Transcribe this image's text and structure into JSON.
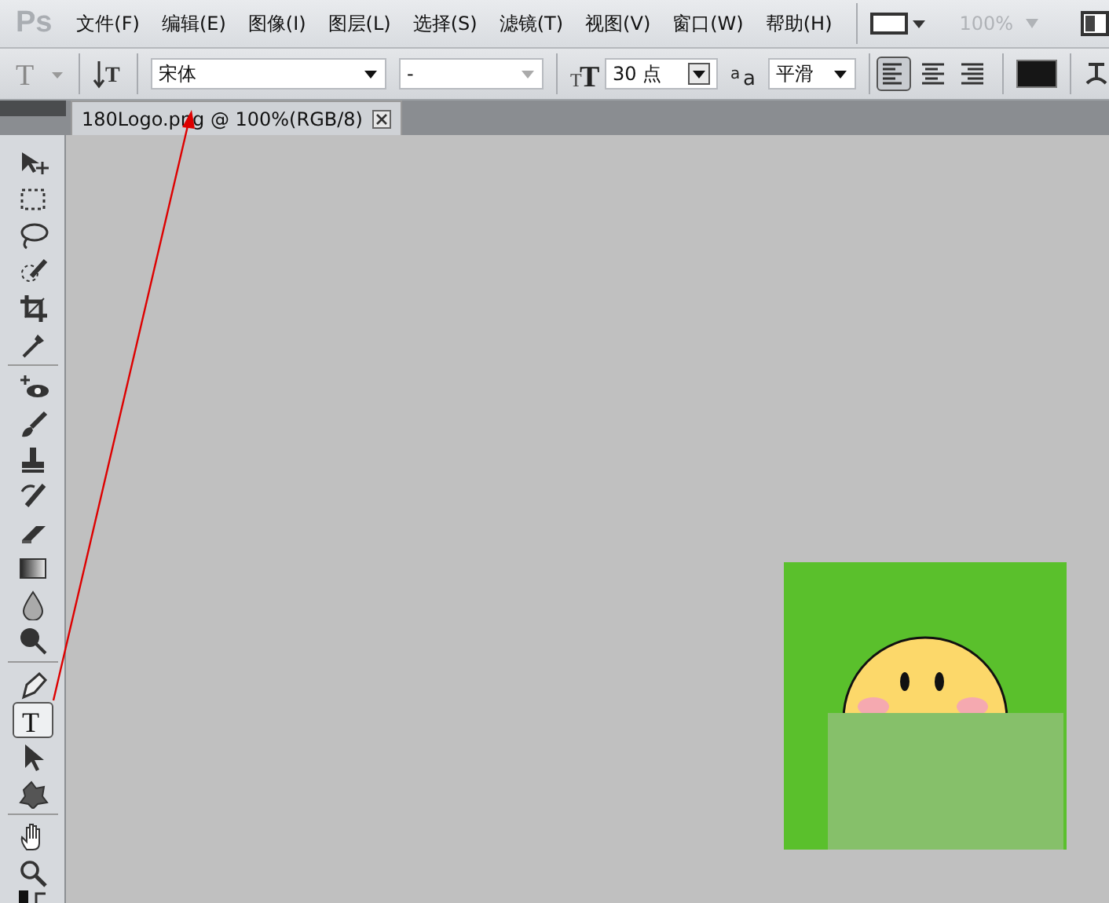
{
  "app_logo": "Ps",
  "menu": [
    {
      "label": "文件(F)"
    },
    {
      "label": "编辑(E)"
    },
    {
      "label": "图像(I)"
    },
    {
      "label": "图层(L)"
    },
    {
      "label": "选择(S)"
    },
    {
      "label": "滤镜(T)"
    },
    {
      "label": "视图(V)"
    },
    {
      "label": "窗口(W)"
    },
    {
      "label": "帮助(H)"
    }
  ],
  "zoom_level": {
    "value": "100%",
    "disabled": true
  },
  "options_bar": {
    "tool_preset_glyph": "T",
    "orientation_glyph": "T",
    "font_size_glyphs": [
      "T",
      "T"
    ],
    "antialias_glyphs": [
      "a",
      "a"
    ],
    "font_family": "宋体",
    "font_style": "-",
    "font_size": "30 点",
    "antialias": "平滑",
    "alignment": [
      {
        "selected": true
      },
      {
        "selected": false
      },
      {
        "selected": false
      }
    ]
  },
  "document_tab": {
    "title": "180Logo.png @ 100%(RGB/8)"
  },
  "toolbox": [
    [
      {
        "selected": false
      },
      {
        "selected": false
      },
      {
        "selected": false
      },
      {
        "selected": false
      },
      {
        "selected": false
      },
      {
        "selected": false
      }
    ],
    [
      {
        "selected": false
      },
      {
        "selected": false
      },
      {
        "selected": false
      },
      {
        "selected": false
      },
      {
        "selected": false
      },
      {
        "selected": false
      },
      {
        "selected": false
      },
      {
        "selected": false
      }
    ],
    [
      {
        "selected": false
      },
      {
        "selected": true,
        "glyph": "T"
      },
      {
        "selected": false
      },
      {
        "selected": false
      }
    ],
    [
      {
        "selected": false
      },
      {
        "selected": false
      }
    ]
  ]
}
